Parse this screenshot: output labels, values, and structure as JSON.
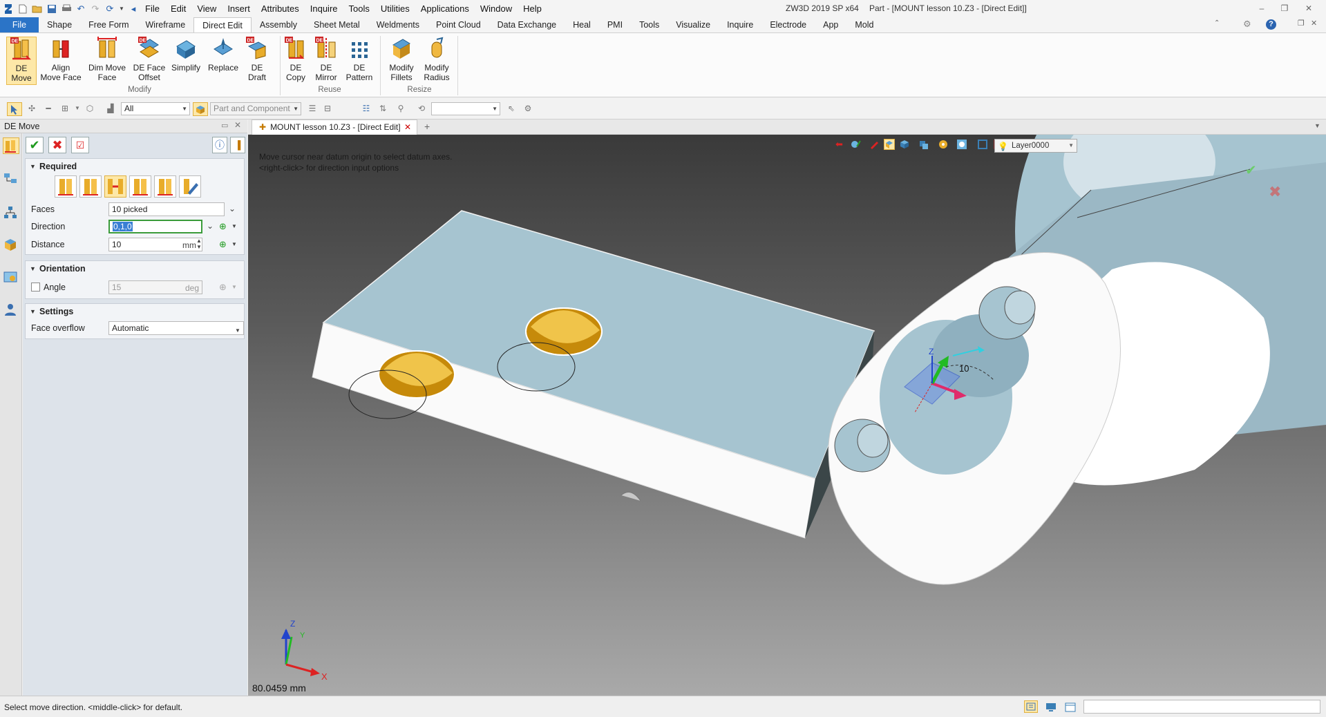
{
  "titlebar": {
    "app_title": "ZW3D 2019 SP x64",
    "doc_title": "Part - [MOUNT lesson 10.Z3 - [Direct Edit]]",
    "menus": [
      "File",
      "Edit",
      "View",
      "Insert",
      "Attributes",
      "Inquire",
      "Tools",
      "Utilities",
      "Applications",
      "Window",
      "Help"
    ]
  },
  "ribbon_tabs": [
    "File",
    "Shape",
    "Free Form",
    "Wireframe",
    "Direct Edit",
    "Assembly",
    "Sheet Metal",
    "Weldments",
    "Point Cloud",
    "Data Exchange",
    "Heal",
    "PMI",
    "Tools",
    "Visualize",
    "Inquire",
    "Electrode",
    "App",
    "Mold"
  ],
  "active_tab": "Direct Edit",
  "ribbon": {
    "modify": {
      "label": "Modify",
      "buttons": [
        {
          "line1": "DE",
          "line2": "Move",
          "icon": "de-move-icon"
        },
        {
          "line1": "Align",
          "line2": "Move Face",
          "icon": "align-move-face-icon"
        },
        {
          "line1": "Dim Move",
          "line2": "Face",
          "icon": "dim-move-face-icon"
        },
        {
          "line1": "DE Face",
          "line2": "Offset",
          "icon": "de-face-offset-icon"
        },
        {
          "line1": "Simplify",
          "line2": "",
          "icon": "simplify-icon"
        },
        {
          "line1": "Replace",
          "line2": "",
          "icon": "replace-icon"
        },
        {
          "line1": "DE",
          "line2": "Draft",
          "icon": "de-draft-icon"
        }
      ]
    },
    "reuse": {
      "label": "Reuse",
      "buttons": [
        {
          "line1": "DE",
          "line2": "Copy",
          "icon": "de-copy-icon"
        },
        {
          "line1": "DE",
          "line2": "Mirror",
          "icon": "de-mirror-icon"
        },
        {
          "line1": "DE",
          "line2": "Pattern",
          "icon": "de-pattern-icon"
        }
      ]
    },
    "resize": {
      "label": "Resize",
      "buttons": [
        {
          "line1": "Modify",
          "line2": "Fillets",
          "icon": "modify-fillets-icon"
        },
        {
          "line1": "Modify",
          "line2": "Radius",
          "icon": "modify-radius-icon"
        }
      ]
    }
  },
  "toolbar2": {
    "filter_value": "All",
    "pick_mode": "Part and Component"
  },
  "panel": {
    "title": "DE Move",
    "required": {
      "title": "Required",
      "faces_label": "Faces",
      "faces_value": "10 picked",
      "direction_label": "Direction",
      "direction_value": "0,1,0",
      "distance_label": "Distance",
      "distance_value": "10",
      "distance_unit": "mm"
    },
    "orientation": {
      "title": "Orientation",
      "angle_label": "Angle",
      "angle_value": "15",
      "angle_unit": "deg"
    },
    "settings": {
      "title": "Settings",
      "overflow_label": "Face overflow",
      "overflow_value": "Automatic"
    }
  },
  "doc_tab": "MOUNT lesson 10.Z3 - [Direct Edit]",
  "viewport": {
    "layer": "Layer0000",
    "hint_line1": "Move cursor near datum origin to select datum axes.",
    "hint_line2": "<right-click> for direction input options",
    "dimension_label": "10",
    "measure": "80.0459 mm",
    "axis_x": "X",
    "axis_y": "Y",
    "axis_z": "Z"
  },
  "status": {
    "text": "Select move direction.  <middle-click> for default."
  },
  "colors": {
    "face_blue": "#a6c4d0",
    "hole_gold": "#d9a21b",
    "file_tab": "#2b74c7",
    "active_highlight": "#fde8a8"
  }
}
